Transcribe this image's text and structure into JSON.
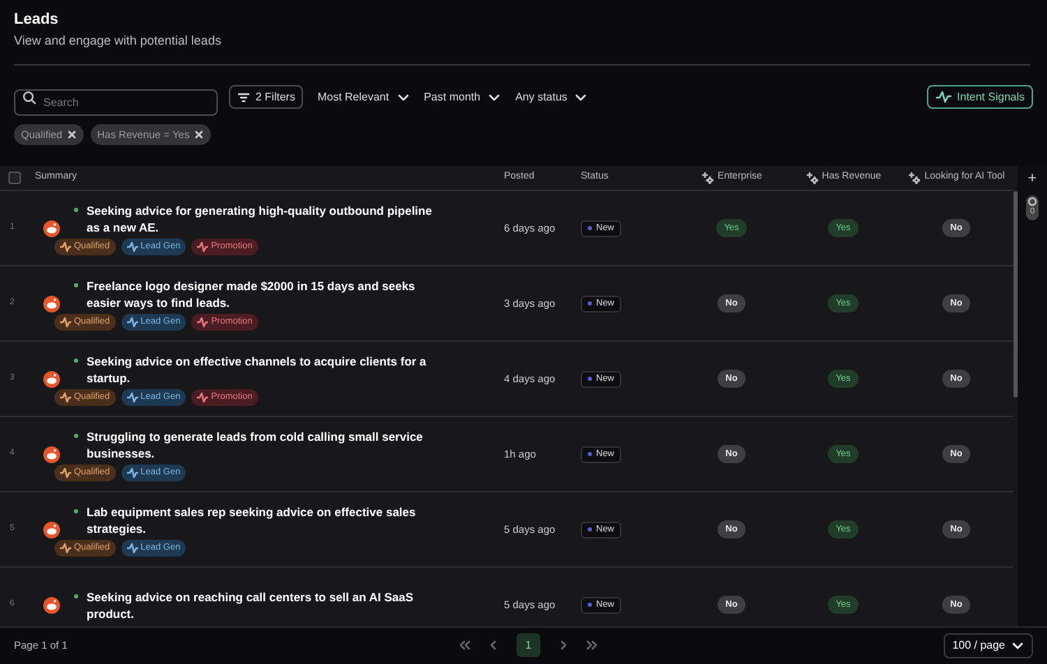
{
  "header": {
    "title": "Leads",
    "subtitle": "View and engage with potential leads"
  },
  "toolbar": {
    "search": {
      "placeholder": "Search"
    },
    "filters_button": "2 Filters",
    "dropdowns": [
      "Most Relevant",
      "Past month",
      "Any status"
    ],
    "intent_button": "Intent Signals"
  },
  "active_filters": [
    "Qualified",
    "Has Revenue = Yes"
  ],
  "table": {
    "select_all": {
      "checked": false
    },
    "columns": [
      {
        "label": "Summary",
        "ai": false
      },
      {
        "label": "Posted",
        "ai": false
      },
      {
        "label": "Status",
        "ai": false
      },
      {
        "label": "Enterprise",
        "ai": true
      },
      {
        "label": "Has Revenue",
        "ai": true
      },
      {
        "label": "Looking for AI Tool",
        "ai": true
      }
    ],
    "rows": [
      {
        "number": "1",
        "summary": "Seeking advice for generating high-quality outbound pipeline as a new AE.",
        "tags": [
          {
            "label": "Qualified",
            "kind": "qualified"
          },
          {
            "label": "Lead Gen",
            "kind": "leadgen"
          },
          {
            "label": "Promotion",
            "kind": "promotion"
          }
        ],
        "posted": "6 days ago",
        "status": "New",
        "signals": [
          {
            "label": "Yes",
            "positive": true
          },
          {
            "label": "Yes",
            "positive": true
          },
          {
            "label": "No",
            "positive": false
          }
        ]
      },
      {
        "number": "2",
        "summary": "Freelance logo designer made $2000 in 15 days and seeks easier ways to find leads.",
        "tags": [
          {
            "label": "Qualified",
            "kind": "qualified"
          },
          {
            "label": "Lead Gen",
            "kind": "leadgen"
          },
          {
            "label": "Promotion",
            "kind": "promotion"
          }
        ],
        "posted": "3 days ago",
        "status": "New",
        "signals": [
          {
            "label": "No",
            "positive": false
          },
          {
            "label": "Yes",
            "positive": true
          },
          {
            "label": "No",
            "positive": false
          }
        ]
      },
      {
        "number": "3",
        "summary": "Seeking advice on effective channels to acquire clients for a startup.",
        "tags": [
          {
            "label": "Qualified",
            "kind": "qualified"
          },
          {
            "label": "Lead Gen",
            "kind": "leadgen"
          },
          {
            "label": "Promotion",
            "kind": "promotion"
          }
        ],
        "posted": "4 days ago",
        "status": "New",
        "signals": [
          {
            "label": "No",
            "positive": false
          },
          {
            "label": "Yes",
            "positive": true
          },
          {
            "label": "No",
            "positive": false
          }
        ]
      },
      {
        "number": "4",
        "summary": "Struggling to generate leads from cold calling small service businesses.",
        "tags": [
          {
            "label": "Qualified",
            "kind": "qualified"
          },
          {
            "label": "Lead Gen",
            "kind": "leadgen"
          }
        ],
        "posted": "1h ago",
        "status": "New",
        "signals": [
          {
            "label": "No",
            "positive": false
          },
          {
            "label": "Yes",
            "positive": true
          },
          {
            "label": "No",
            "positive": false
          }
        ]
      },
      {
        "number": "5",
        "summary": "Lab equipment sales rep seeking advice on effective sales strategies.",
        "tags": [
          {
            "label": "Qualified",
            "kind": "qualified"
          },
          {
            "label": "Lead Gen",
            "kind": "leadgen"
          }
        ],
        "posted": "5 days ago",
        "status": "New",
        "signals": [
          {
            "label": "No",
            "positive": false
          },
          {
            "label": "Yes",
            "positive": true
          },
          {
            "label": "No",
            "positive": false
          }
        ]
      },
      {
        "number": "6",
        "summary": "Seeking advice on reaching call centers to sell an AI SaaS product.",
        "tags": [],
        "posted": "5 days ago",
        "status": "New",
        "signals": [
          {
            "label": "No",
            "positive": false
          },
          {
            "label": "Yes",
            "positive": true
          },
          {
            "label": "No",
            "positive": false
          }
        ]
      }
    ]
  },
  "side_panel": {
    "add_button": "+",
    "badge": "0"
  },
  "footer": {
    "page_info": "Page 1 of 1",
    "pages": [
      {
        "label": "1",
        "selected": true
      }
    ],
    "page_size": "100 / page"
  }
}
